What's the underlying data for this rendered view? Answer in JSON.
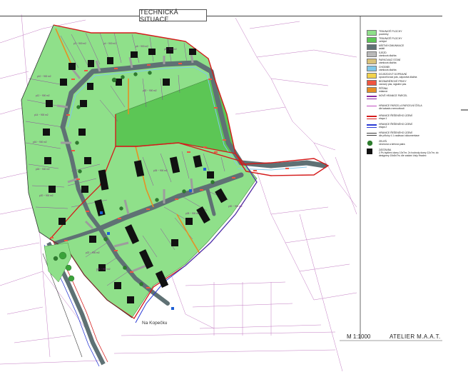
{
  "header": {
    "title": "TECHNICKÁ SITUACE"
  },
  "footer": {
    "scale": "M 1:1000",
    "studio": "ATELIER M.A.A.T."
  },
  "map": {
    "street_label": "Na Kopečku"
  },
  "legend": [
    {
      "label": "TRAVNATÉ PLOCHY",
      "sub": "pozemky",
      "color": "#8fe08a",
      "style": "fill",
      "icon": "grass-area-icon"
    },
    {
      "label": "TRAVNATÉ PLOCHY",
      "sub": "veřejné",
      "color": "#5cc655",
      "style": "fill",
      "icon": "public-grass-icon"
    },
    {
      "label": "MÍSTNÍ KOMUNIKACE",
      "sub": "asfalt",
      "color": "#5f7174",
      "style": "fill",
      "icon": "road-icon"
    },
    {
      "label": "SJEZD",
      "sub": "zámková dlažba",
      "color": "#b9b9b9",
      "style": "fill",
      "icon": "driveway-icon"
    },
    {
      "label": "PARKOVACÍ STÁNÍ",
      "sub": "zámková dlažba",
      "color": "#d9c27a",
      "style": "fill",
      "icon": "parking-icon"
    },
    {
      "label": "CHODNÍK",
      "sub": "zámková dlažba",
      "color": "#7fc7e8",
      "style": "fill",
      "icon": "sidewalk-icon"
    },
    {
      "label": "DOJEZDOVÝ DOPRAVNÍ",
      "sub": "upozorňovací pás, zápustná dlažba",
      "color": "#f2d24c",
      "style": "fill",
      "icon": "traffic-strip-icon"
    },
    {
      "label": "BEZBARIÉROVÉ PRVKY",
      "sub": "varovný pás, signální pás",
      "color": "#ef5540",
      "style": "fill",
      "icon": "barrier-free-icon"
    },
    {
      "label": "PĚŠINA",
      "sub": "mlatová",
      "color": "#e69024",
      "style": "fill",
      "icon": "footpath-icon"
    },
    {
      "label": "NOVÉ HRANICE PARCEL",
      "sub": "",
      "color": "#8a2aa0",
      "style": "line",
      "icon": "new-parcel-line-icon"
    },
    {
      "label": "HRANICE PARCEL A PARCELNÍ ČÍSLA",
      "sub": "dle katastru nemovitostí",
      "color": "#c04cc0",
      "style": "line-thin",
      "icon": "parcel-boundary-icon"
    },
    {
      "label": "HRANICE ŘEŠENÉHO ÚZEMÍ",
      "sub": "etapa 1",
      "color": "#d41b1b",
      "style": "line",
      "icon": "area-stage-1-icon"
    },
    {
      "label": "HRANICE ŘEŠENÉHO ÚZEMÍ",
      "sub": "etapa 2",
      "color": "#2a3ad4",
      "style": "line",
      "icon": "area-stage-2-icon"
    },
    {
      "label": "HRANICE ŘEŠENÉHO ÚZEMÍ",
      "sub": "dle přílohy č.1 zadávací dokumentace",
      "color": "#3b3b3b",
      "style": "line-double",
      "icon": "area-boundary-icon"
    },
    {
      "label": "ZELEŇ",
      "sub": "stromová a keřová patra",
      "color": "#2e7d2e",
      "style": "tree",
      "icon": "tree-icon"
    },
    {
      "label": "ZÁSTAVBA",
      "sub": "2.Ps bydlení domy 10x7m; 2x hodnoty domy 12x7m; do designery 15x8x7m; dle zadání čísly Hradec",
      "color": "#111111",
      "style": "house",
      "icon": "building-icon"
    }
  ],
  "lot_area_labels": [
    "p2 ~ 900 m2",
    "p4 ~ 900 m2",
    "p6 ~ 900 m2",
    "p8 ~ 900 m2",
    "p10 ~ 900 m2",
    "p12 ~ 900 m2",
    "p14 ~ 900 m2",
    "p16 ~ 900 m2",
    "p18 ~ 900 m2",
    "p20 ~ 900 m2",
    "p22 ~ 900 m2",
    "p24 ~ 900 m2",
    "p26 ~ 900 m2",
    "p28 ~ 900 m2",
    "p30 ~ 900 m2",
    "p32 ~ 900 m2"
  ]
}
